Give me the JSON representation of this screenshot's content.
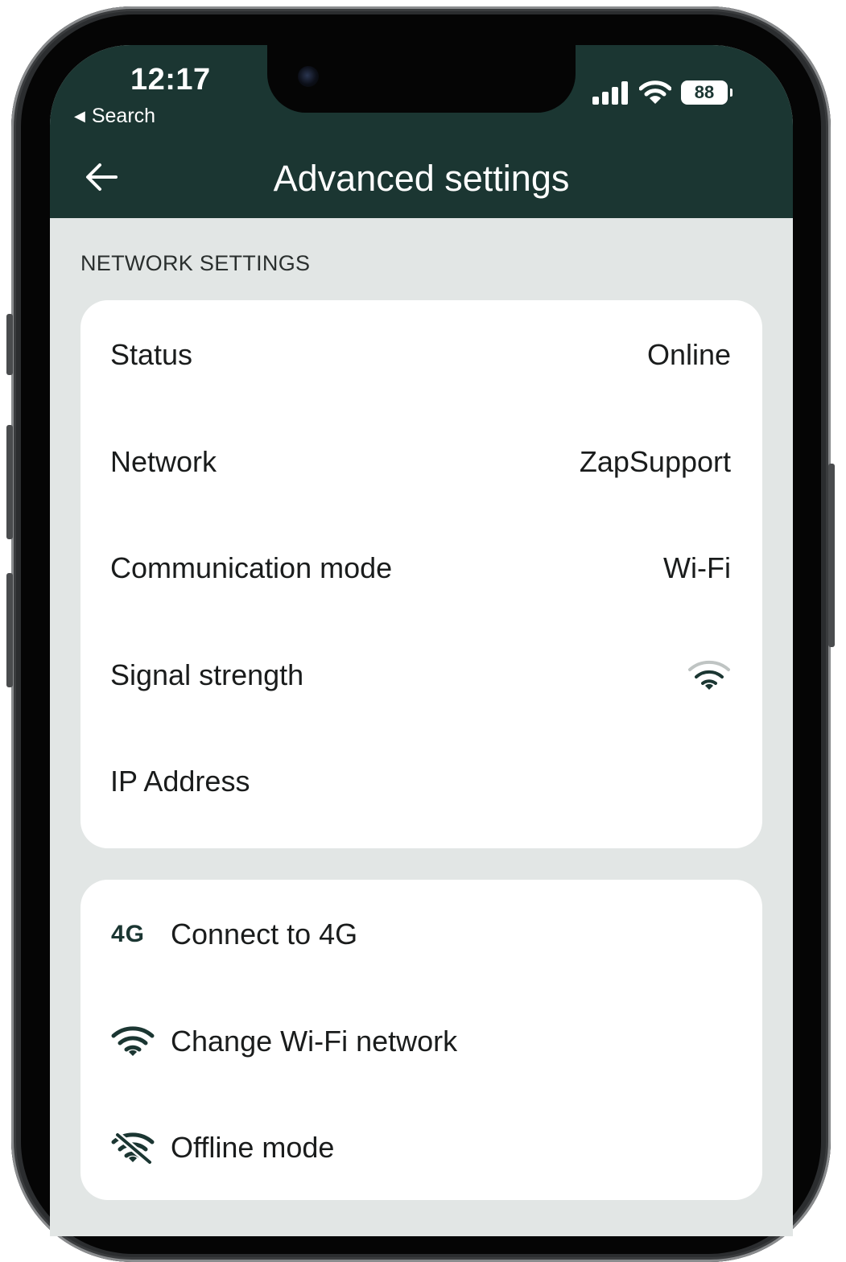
{
  "status_bar": {
    "time": "12:17",
    "back_label": "Search",
    "back_arrow_glyph": "◀",
    "battery_level": "88"
  },
  "header": {
    "title": "Advanced settings",
    "background_color": "#1b3632"
  },
  "network_settings": {
    "section_label": "NETWORK SETTINGS",
    "rows": [
      {
        "label": "Status",
        "value": "Online"
      },
      {
        "label": "Network",
        "value": "ZapSupport"
      },
      {
        "label": "Communication mode",
        "value": "Wi-Fi"
      },
      {
        "label": "Signal strength",
        "icon": "wifi-signal-icon"
      },
      {
        "label": "IP Address",
        "value": ""
      }
    ]
  },
  "actions": [
    {
      "label": "Connect to 4G",
      "icon_text": "4G",
      "icon": "4g-icon"
    },
    {
      "label": "Change Wi-Fi network",
      "icon": "wifi-icon"
    },
    {
      "label": "Offline mode",
      "icon": "wifi-off-icon"
    }
  ]
}
